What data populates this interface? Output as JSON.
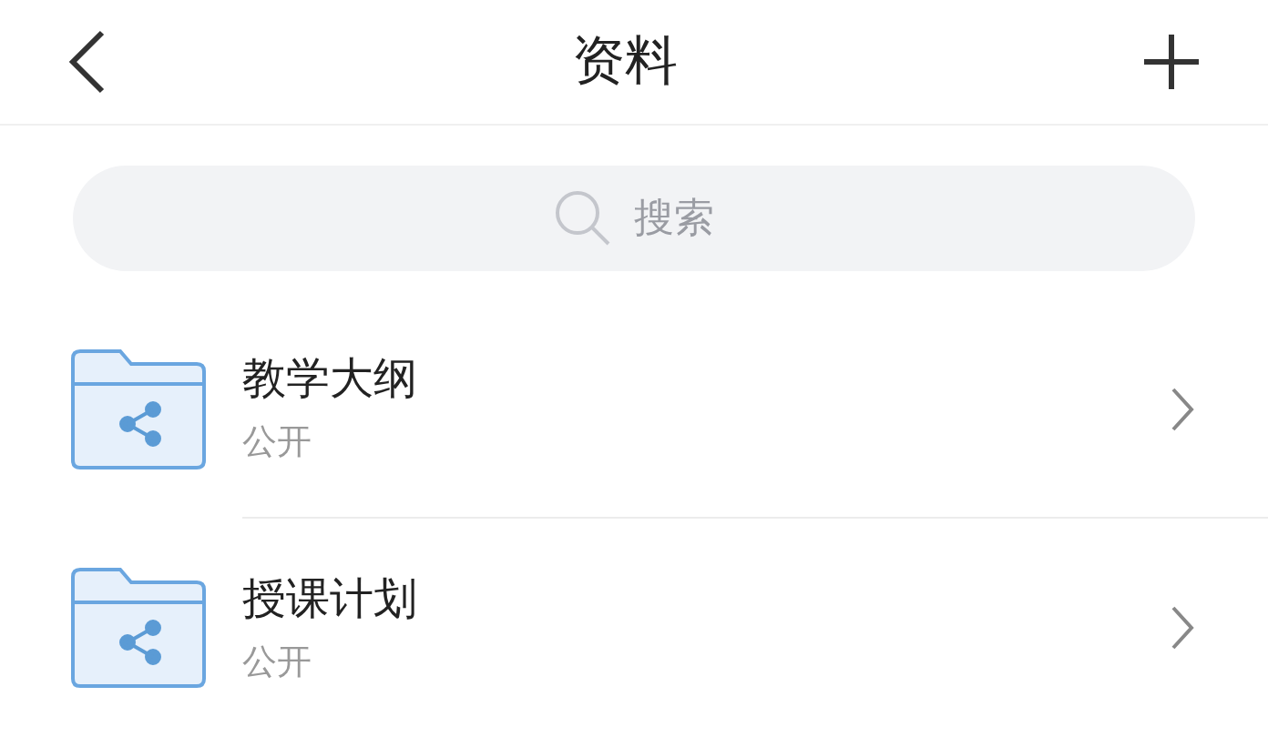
{
  "header": {
    "title": "资料"
  },
  "search": {
    "placeholder": "搜索"
  },
  "items": [
    {
      "name": "教学大纲",
      "visibility": "公开"
    },
    {
      "name": "授课计划",
      "visibility": "公开"
    }
  ]
}
